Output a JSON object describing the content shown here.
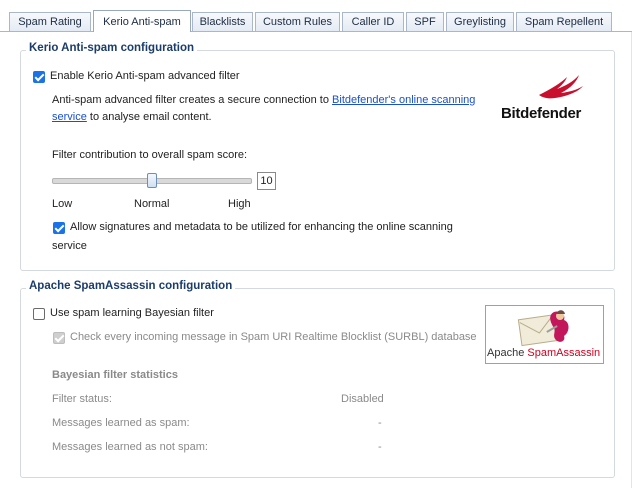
{
  "tabs": [
    {
      "label": "Spam Rating",
      "active": false
    },
    {
      "label": "Kerio Anti-spam",
      "active": true
    },
    {
      "label": "Blacklists",
      "active": false
    },
    {
      "label": "Custom Rules",
      "active": false
    },
    {
      "label": "Caller ID",
      "active": false
    },
    {
      "label": "SPF",
      "active": false
    },
    {
      "label": "Greylisting",
      "active": false
    },
    {
      "label": "Spam Repellent",
      "active": false
    }
  ],
  "kerio": {
    "legend": "Kerio Anti-spam configuration",
    "enable_label": "Enable Kerio Anti-spam advanced filter",
    "enable_checked": true,
    "desc_prefix": "Anti-spam advanced filter creates a secure connection to ",
    "desc_link_part1": "Bitdefender's online scanning",
    "desc_link_part2": "service",
    "desc_suffix": " to analyse email content.",
    "logo_text": "Bitdefender",
    "contribution_label": "Filter contribution to overall spam score:",
    "slider_value": "10",
    "slider_level_fraction": 0.5,
    "scale_low": "Low",
    "scale_normal": "Normal",
    "scale_high": "High",
    "allow_label_line1": "Allow signatures and metadata to be utilized for enhancing the online scanning",
    "allow_label_line2": "service",
    "allow_checked": true
  },
  "spamassassin": {
    "legend": "Apache SpamAssassin configuration",
    "bayes_label": "Use spam learning Bayesian filter",
    "bayes_checked": false,
    "surbl_label": "Check every incoming message in Spam URI Realtime Blocklist (SURBL) database",
    "surbl_checked": true,
    "surbl_disabled": true,
    "logo_text_prefix": "Apache ",
    "logo_text_brand": "SpamAssassin",
    "stats_title": "Bayesian filter statistics",
    "stats": [
      {
        "label": "Filter status:",
        "value": "Disabled"
      },
      {
        "label": "Messages learned as spam:",
        "value": "-"
      },
      {
        "label": "Messages learned as not spam:",
        "value": "-"
      }
    ]
  },
  "colors": {
    "legend": "#1c3c6a",
    "link": "#1a4fd0",
    "checkbox_checked": "#1a73e8",
    "bitdefender_red": "#c8102e",
    "spamassassin_red": "#d1001f"
  }
}
